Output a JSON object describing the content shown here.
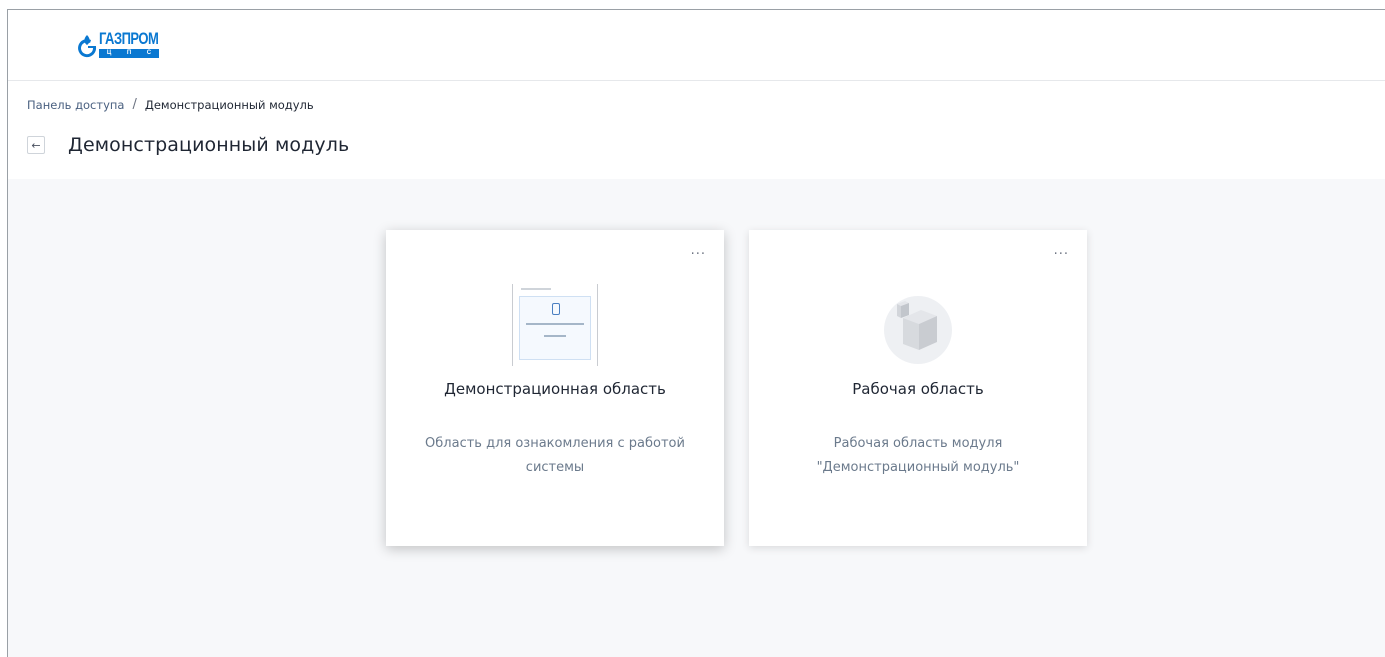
{
  "brand": {
    "name": "ГАЗПРОМ",
    "sub_letters": [
      "Ц",
      "П",
      "С"
    ],
    "color": "#0a78d1"
  },
  "breadcrumb": {
    "root": "Панель доступа",
    "separator": "/",
    "current": "Демонстрационный модуль"
  },
  "page": {
    "title": "Демонстрационный модуль",
    "back_icon": "arrow-left-icon"
  },
  "cards": [
    {
      "title": "Демонстрационная область",
      "description": "Область для ознакомления с работой системы",
      "menu": "...",
      "icon": "document-preview-icon"
    },
    {
      "title": "Рабочая область",
      "description": "Рабочая область модуля \"Демонстрационный модуль\"",
      "menu": "...",
      "icon": "cube-icon"
    }
  ]
}
